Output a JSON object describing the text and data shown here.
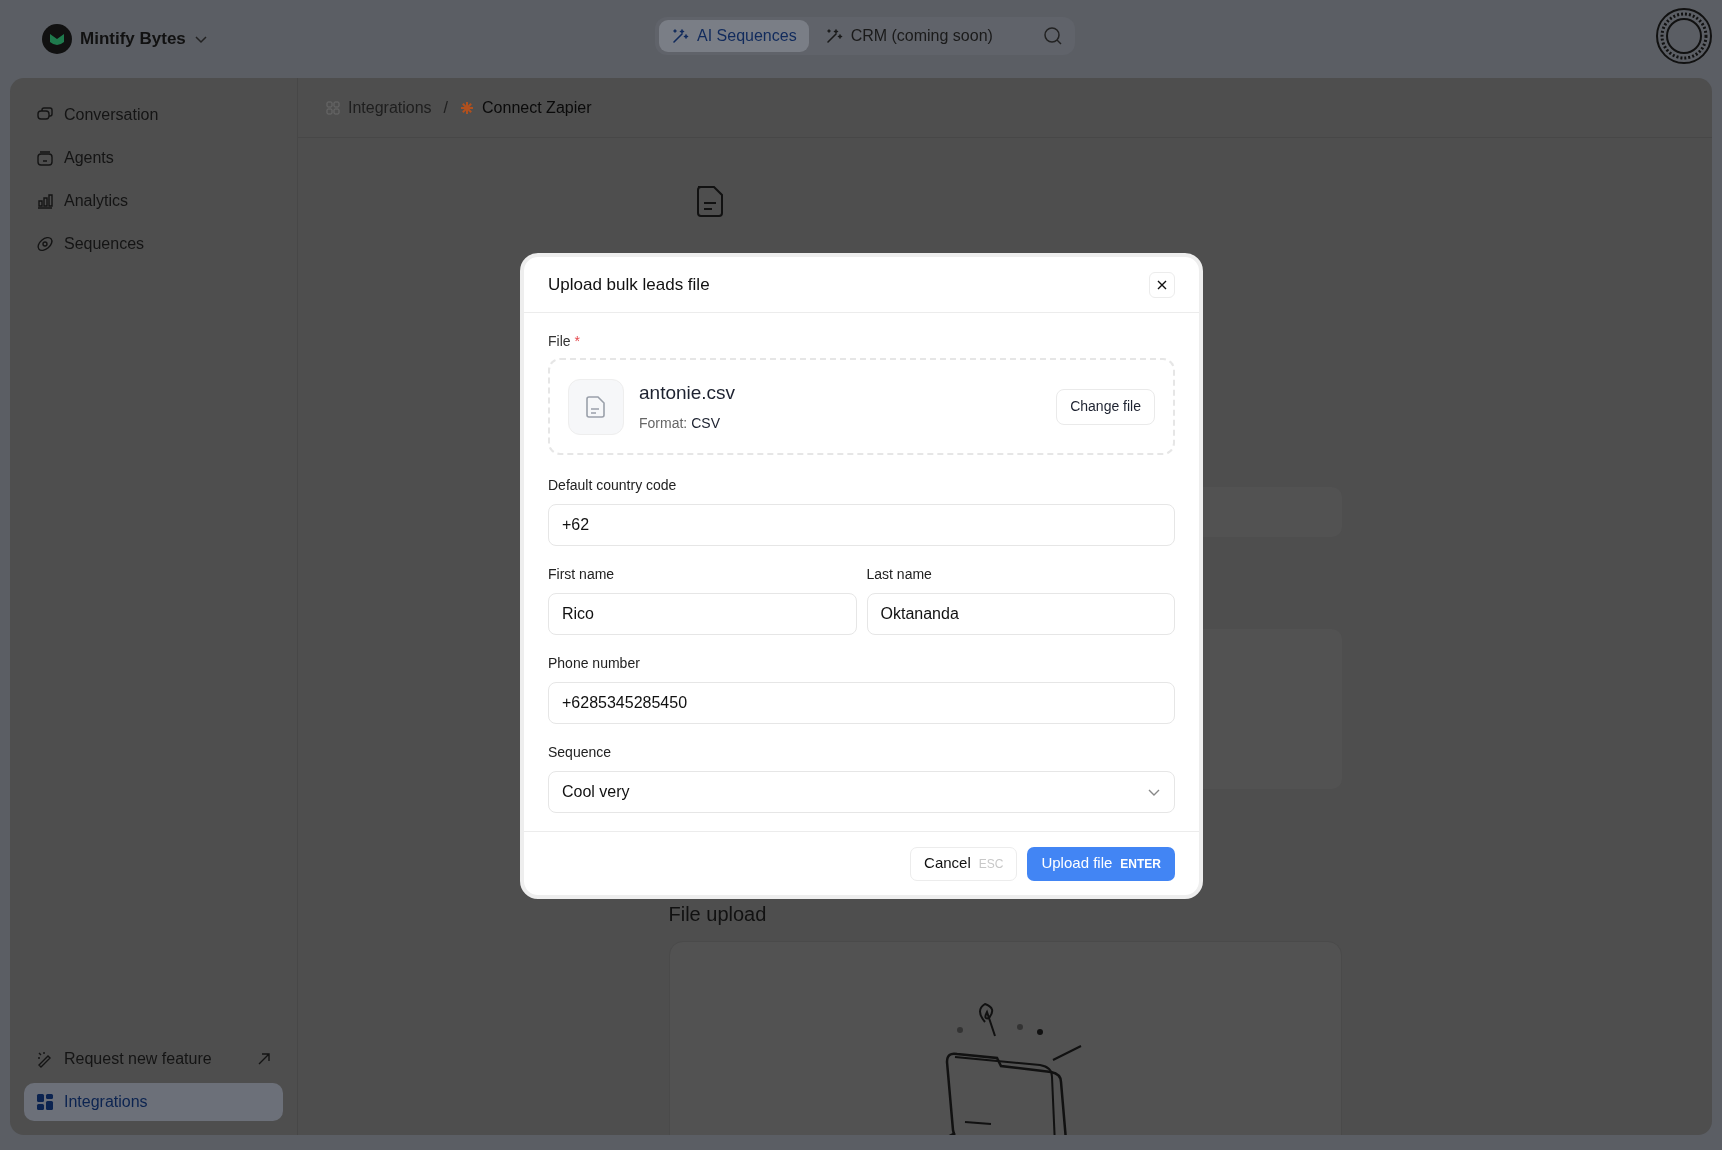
{
  "workspace": {
    "name": "Mintify Bytes"
  },
  "top_nav": {
    "tabs": [
      {
        "label": "AI Sequences",
        "selected": true
      },
      {
        "label": "CRM (coming soon)",
        "selected": false
      }
    ]
  },
  "sidebar": {
    "items": [
      {
        "label": "Conversation",
        "selected": false
      },
      {
        "label": "Agents",
        "selected": false
      },
      {
        "label": "Analytics",
        "selected": false
      },
      {
        "label": "Sequences",
        "selected": false
      }
    ],
    "bottom_items": [
      {
        "label": "Request new feature",
        "selected": false,
        "external": true
      },
      {
        "label": "Integrations",
        "selected": true,
        "external": false
      }
    ]
  },
  "breadcrumb": [
    "Integrations",
    "Connect Zapier"
  ],
  "breadcrumb_separator": "/",
  "page": {
    "section_title": "File upload"
  },
  "modal": {
    "title": "Upload bulk leads file",
    "file": {
      "label": "File",
      "required_mark": "*",
      "name": "antonie.csv",
      "format_label": "Format:",
      "format": "CSV",
      "button": "Change file"
    },
    "rows": [
      [
        {
          "kind": "text",
          "label": "Default country code",
          "value": "+62"
        }
      ],
      [
        {
          "kind": "text",
          "label": "First name",
          "value": "Rico"
        },
        {
          "kind": "text",
          "label": "Last name",
          "value": "Oktananda"
        }
      ],
      [
        {
          "kind": "text",
          "label": "Phone number",
          "value": "+6285345285450"
        }
      ],
      [
        {
          "kind": "select",
          "label": "Sequence",
          "value": "Cool very"
        }
      ]
    ],
    "buttons": [
      {
        "kind": "secondary",
        "label": "Cancel",
        "shortcut": "ESC"
      },
      {
        "kind": "primary",
        "label": "Upload file",
        "shortcut": "ENTER"
      }
    ]
  }
}
